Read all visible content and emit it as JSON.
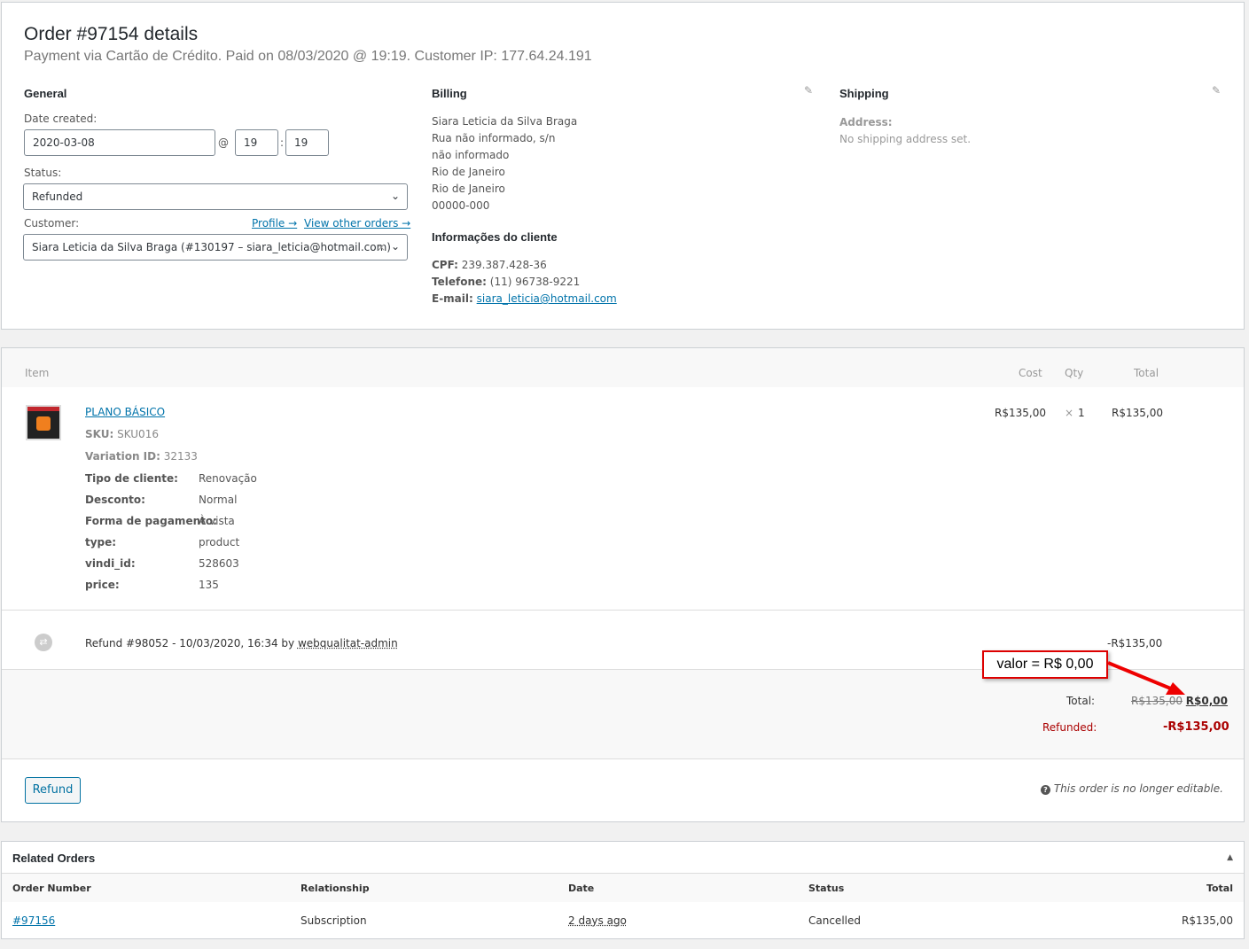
{
  "header": {
    "title": "Order #97154 details",
    "subtitle": "Payment via Cartão de Crédito. Paid on 08/03/2020 @ 19:19. Customer IP: 177.64.24.191"
  },
  "general": {
    "heading": "General",
    "date_label": "Date created:",
    "date": "2020-03-08",
    "at": "@",
    "hour": "19",
    "colon": ":",
    "minute": "19",
    "status_label": "Status:",
    "status": "Refunded",
    "customer_label": "Customer:",
    "profile_link": "Profile →",
    "orders_link": "View other orders →",
    "customer": "Siara Leticia da Silva Braga (#130197 – siara_leticia@hotmail.com)",
    "clear": "×"
  },
  "billing": {
    "heading": "Billing",
    "lines": [
      "Siara Leticia da Silva Braga",
      "Rua não informado, s/n",
      "não informado",
      "Rio de Janeiro",
      "Rio de Janeiro",
      "00000-000"
    ],
    "info_heading": "Informações do cliente",
    "cpf_label": "CPF:",
    "cpf": "239.387.428-36",
    "phone_label": "Telefone:",
    "phone": "(11) 96738-9221",
    "email_label": "E-mail:",
    "email": "siara_leticia@hotmail.com"
  },
  "shipping": {
    "heading": "Shipping",
    "address_label": "Address:",
    "address": "No shipping address set."
  },
  "items": {
    "headers": {
      "item": "Item",
      "cost": "Cost",
      "qty": "Qty",
      "total": "Total"
    },
    "name": "PLANO BÁSICO",
    "sku_label": "SKU:",
    "sku": "SKU016",
    "variation_label": "Variation ID:",
    "variation": "32133",
    "meta": [
      {
        "k": "Tipo de cliente:",
        "v": "Renovação"
      },
      {
        "k": "Desconto:",
        "v": "Normal"
      },
      {
        "k": "Forma de pagamento:",
        "v": "À vista"
      },
      {
        "k": "type:",
        "v": "product"
      },
      {
        "k": "vindi_id:",
        "v": "528603"
      },
      {
        "k": "price:",
        "v": "135"
      }
    ],
    "cost": "R$135,00",
    "qty_x": "×",
    "qty": "1",
    "total": "R$135,00"
  },
  "refund": {
    "text": "Refund #98052 - 10/03/2020, 16:34 by ",
    "user": "webqualitat-admin",
    "amount": "-R$135,00"
  },
  "annotation": {
    "text": "valor = R$ 0,00"
  },
  "totals": {
    "total_label": "Total:",
    "old_total": "R$135,00",
    "new_total": "R$0,00",
    "refunded_label": "Refunded:",
    "refunded": "-R$135,00"
  },
  "actions": {
    "refund_button": "Refund",
    "note": "This order is no longer editable."
  },
  "related": {
    "title": "Related Orders",
    "headers": [
      "Order Number",
      "Relationship",
      "Date",
      "Status",
      "Total"
    ],
    "rows": [
      {
        "number": "#97156",
        "relationship": "Subscription",
        "date": "2 days ago",
        "status": "Cancelled",
        "total": "R$135,00"
      }
    ]
  }
}
